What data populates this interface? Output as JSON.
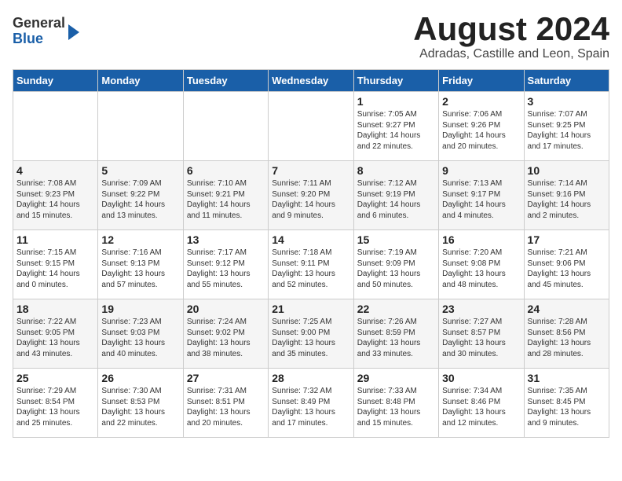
{
  "header": {
    "logo_general": "General",
    "logo_blue": "Blue",
    "month_title": "August 2024",
    "location": "Adradas, Castille and Leon, Spain"
  },
  "days_of_week": [
    "Sunday",
    "Monday",
    "Tuesday",
    "Wednesday",
    "Thursday",
    "Friday",
    "Saturday"
  ],
  "weeks": [
    [
      {
        "day": "",
        "content": ""
      },
      {
        "day": "",
        "content": ""
      },
      {
        "day": "",
        "content": ""
      },
      {
        "day": "",
        "content": ""
      },
      {
        "day": "1",
        "content": "Sunrise: 7:05 AM\nSunset: 9:27 PM\nDaylight: 14 hours\nand 22 minutes."
      },
      {
        "day": "2",
        "content": "Sunrise: 7:06 AM\nSunset: 9:26 PM\nDaylight: 14 hours\nand 20 minutes."
      },
      {
        "day": "3",
        "content": "Sunrise: 7:07 AM\nSunset: 9:25 PM\nDaylight: 14 hours\nand 17 minutes."
      }
    ],
    [
      {
        "day": "4",
        "content": "Sunrise: 7:08 AM\nSunset: 9:23 PM\nDaylight: 14 hours\nand 15 minutes."
      },
      {
        "day": "5",
        "content": "Sunrise: 7:09 AM\nSunset: 9:22 PM\nDaylight: 14 hours\nand 13 minutes."
      },
      {
        "day": "6",
        "content": "Sunrise: 7:10 AM\nSunset: 9:21 PM\nDaylight: 14 hours\nand 11 minutes."
      },
      {
        "day": "7",
        "content": "Sunrise: 7:11 AM\nSunset: 9:20 PM\nDaylight: 14 hours\nand 9 minutes."
      },
      {
        "day": "8",
        "content": "Sunrise: 7:12 AM\nSunset: 9:19 PM\nDaylight: 14 hours\nand 6 minutes."
      },
      {
        "day": "9",
        "content": "Sunrise: 7:13 AM\nSunset: 9:17 PM\nDaylight: 14 hours\nand 4 minutes."
      },
      {
        "day": "10",
        "content": "Sunrise: 7:14 AM\nSunset: 9:16 PM\nDaylight: 14 hours\nand 2 minutes."
      }
    ],
    [
      {
        "day": "11",
        "content": "Sunrise: 7:15 AM\nSunset: 9:15 PM\nDaylight: 14 hours\nand 0 minutes."
      },
      {
        "day": "12",
        "content": "Sunrise: 7:16 AM\nSunset: 9:13 PM\nDaylight: 13 hours\nand 57 minutes."
      },
      {
        "day": "13",
        "content": "Sunrise: 7:17 AM\nSunset: 9:12 PM\nDaylight: 13 hours\nand 55 minutes."
      },
      {
        "day": "14",
        "content": "Sunrise: 7:18 AM\nSunset: 9:11 PM\nDaylight: 13 hours\nand 52 minutes."
      },
      {
        "day": "15",
        "content": "Sunrise: 7:19 AM\nSunset: 9:09 PM\nDaylight: 13 hours\nand 50 minutes."
      },
      {
        "day": "16",
        "content": "Sunrise: 7:20 AM\nSunset: 9:08 PM\nDaylight: 13 hours\nand 48 minutes."
      },
      {
        "day": "17",
        "content": "Sunrise: 7:21 AM\nSunset: 9:06 PM\nDaylight: 13 hours\nand 45 minutes."
      }
    ],
    [
      {
        "day": "18",
        "content": "Sunrise: 7:22 AM\nSunset: 9:05 PM\nDaylight: 13 hours\nand 43 minutes."
      },
      {
        "day": "19",
        "content": "Sunrise: 7:23 AM\nSunset: 9:03 PM\nDaylight: 13 hours\nand 40 minutes."
      },
      {
        "day": "20",
        "content": "Sunrise: 7:24 AM\nSunset: 9:02 PM\nDaylight: 13 hours\nand 38 minutes."
      },
      {
        "day": "21",
        "content": "Sunrise: 7:25 AM\nSunset: 9:00 PM\nDaylight: 13 hours\nand 35 minutes."
      },
      {
        "day": "22",
        "content": "Sunrise: 7:26 AM\nSunset: 8:59 PM\nDaylight: 13 hours\nand 33 minutes."
      },
      {
        "day": "23",
        "content": "Sunrise: 7:27 AM\nSunset: 8:57 PM\nDaylight: 13 hours\nand 30 minutes."
      },
      {
        "day": "24",
        "content": "Sunrise: 7:28 AM\nSunset: 8:56 PM\nDaylight: 13 hours\nand 28 minutes."
      }
    ],
    [
      {
        "day": "25",
        "content": "Sunrise: 7:29 AM\nSunset: 8:54 PM\nDaylight: 13 hours\nand 25 minutes."
      },
      {
        "day": "26",
        "content": "Sunrise: 7:30 AM\nSunset: 8:53 PM\nDaylight: 13 hours\nand 22 minutes."
      },
      {
        "day": "27",
        "content": "Sunrise: 7:31 AM\nSunset: 8:51 PM\nDaylight: 13 hours\nand 20 minutes."
      },
      {
        "day": "28",
        "content": "Sunrise: 7:32 AM\nSunset: 8:49 PM\nDaylight: 13 hours\nand 17 minutes."
      },
      {
        "day": "29",
        "content": "Sunrise: 7:33 AM\nSunset: 8:48 PM\nDaylight: 13 hours\nand 15 minutes."
      },
      {
        "day": "30",
        "content": "Sunrise: 7:34 AM\nSunset: 8:46 PM\nDaylight: 13 hours\nand 12 minutes."
      },
      {
        "day": "31",
        "content": "Sunrise: 7:35 AM\nSunset: 8:45 PM\nDaylight: 13 hours\nand 9 minutes."
      }
    ]
  ]
}
